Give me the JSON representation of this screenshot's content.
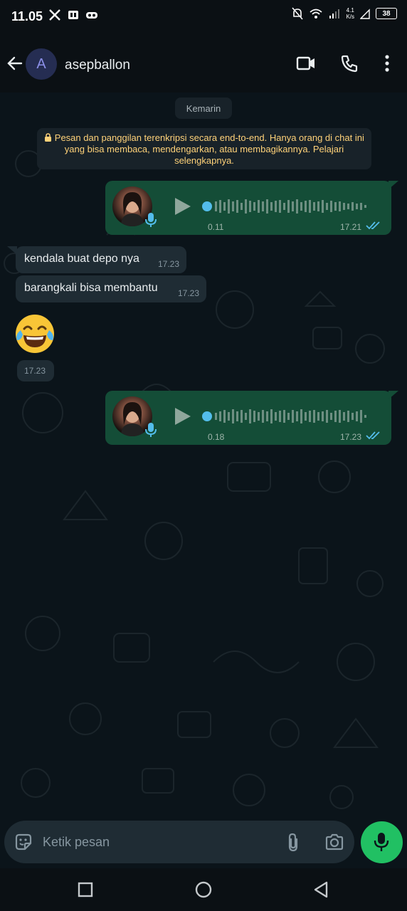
{
  "status_bar": {
    "time": "11.05",
    "battery": "38",
    "net_speed_value": "4.1",
    "net_speed_unit": "K/s"
  },
  "header": {
    "avatar_letter": "A",
    "contact_name": "asepballon"
  },
  "chat": {
    "date_chip": "Kemarin",
    "encryption_notice": "Pesan dan panggilan terenkripsi secara end-to-end. Hanya orang di chat ini yang bisa membaca, mendengarkan, atau membagikannya. Pelajari selengkapnya.",
    "messages": [
      {
        "type": "voice",
        "direction": "out",
        "duration": "0.11",
        "time": "17.21",
        "progress": 0
      },
      {
        "type": "text",
        "direction": "in",
        "text": "kendala buat depo nya",
        "time": "17.23"
      },
      {
        "type": "text",
        "direction": "in",
        "text": "barangkali bisa membantu",
        "time": "17.23"
      },
      {
        "type": "emoji",
        "direction": "in",
        "emoji": "face-with-tears-of-joy",
        "time": "17.23"
      },
      {
        "type": "voice",
        "direction": "out",
        "duration": "0.18",
        "time": "17.23",
        "progress": 0
      }
    ]
  },
  "composer": {
    "placeholder": "Ketik pesan"
  },
  "colors": {
    "outgoing": "#144d37",
    "incoming": "#1f2c34",
    "accent": "#21c063",
    "background": "#0b141a",
    "notice_text": "#ffd279",
    "read_ticks": "#53bdeb"
  },
  "icons": [
    "back-arrow-icon",
    "video-call-icon",
    "phone-icon",
    "more-vert-icon",
    "sticker-icon",
    "attach-icon",
    "camera-icon",
    "mic-icon",
    "nav-recents-icon",
    "nav-home-icon",
    "nav-back-icon"
  ]
}
